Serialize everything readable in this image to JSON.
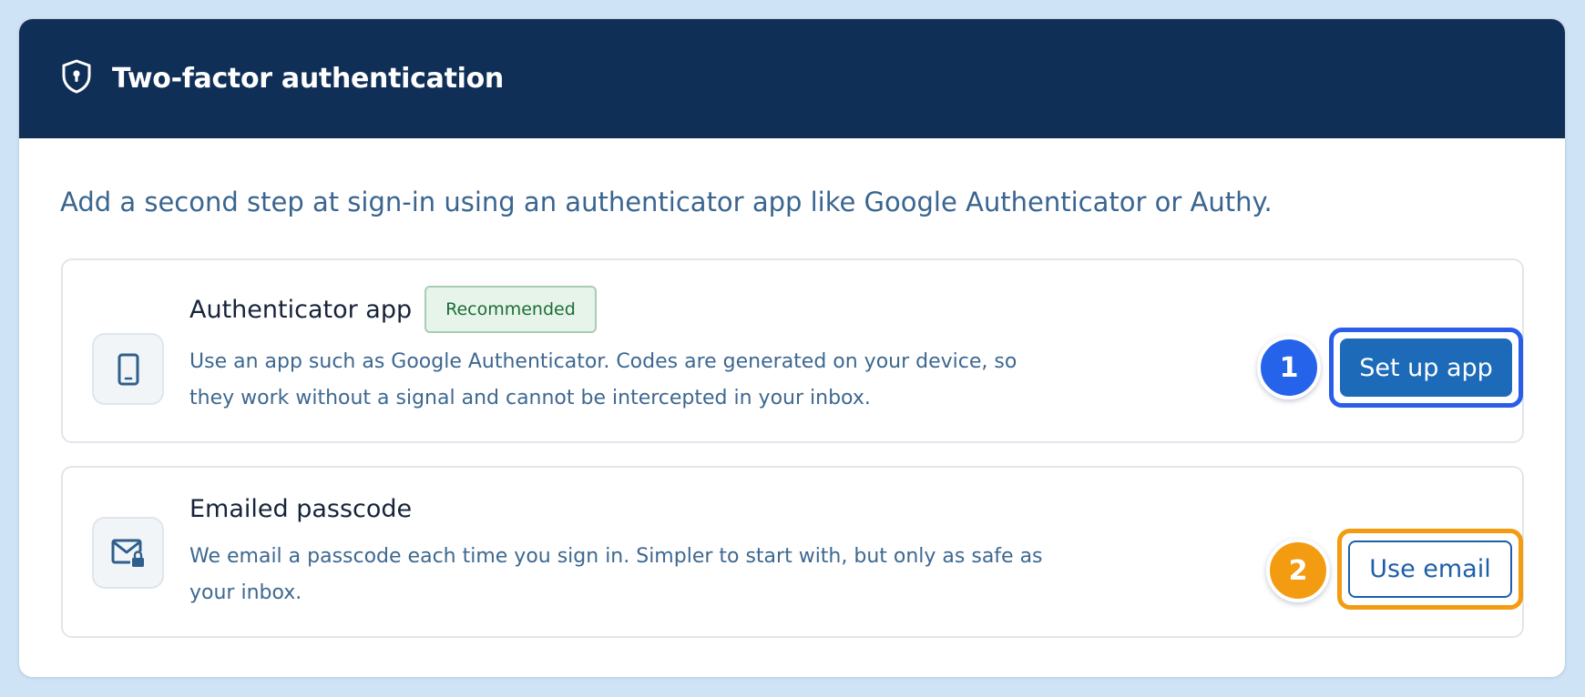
{
  "header": {
    "title": "Two-factor authentication",
    "icon": "shield-lock-icon"
  },
  "intro": "Add a second step at sign-in using an authenticator app like Google Authenticator or Authy.",
  "options": [
    {
      "title": "Authenticator app",
      "badge": "Recommended",
      "description": "Use an app such as Google Authenticator. Codes are generated on your device, so they work without a signal and cannot be intercepted in your inbox.",
      "icon": "smartphone-icon",
      "button_label": "Set up app",
      "marker": "1"
    },
    {
      "title": "Emailed passcode",
      "description": "We email a passcode each time you sign in. Simpler to start with, but only as safe as your inbox.",
      "icon": "mail-lock-icon",
      "button_label": "Use email",
      "marker": "2"
    }
  ],
  "colors": {
    "header_bg": "#0f2f57",
    "primary": "#1d6bb8",
    "marker_1": "#2563eb",
    "marker_2": "#f39c12",
    "badge_bg": "#e7f4ea",
    "badge_text": "#1b6e36"
  }
}
